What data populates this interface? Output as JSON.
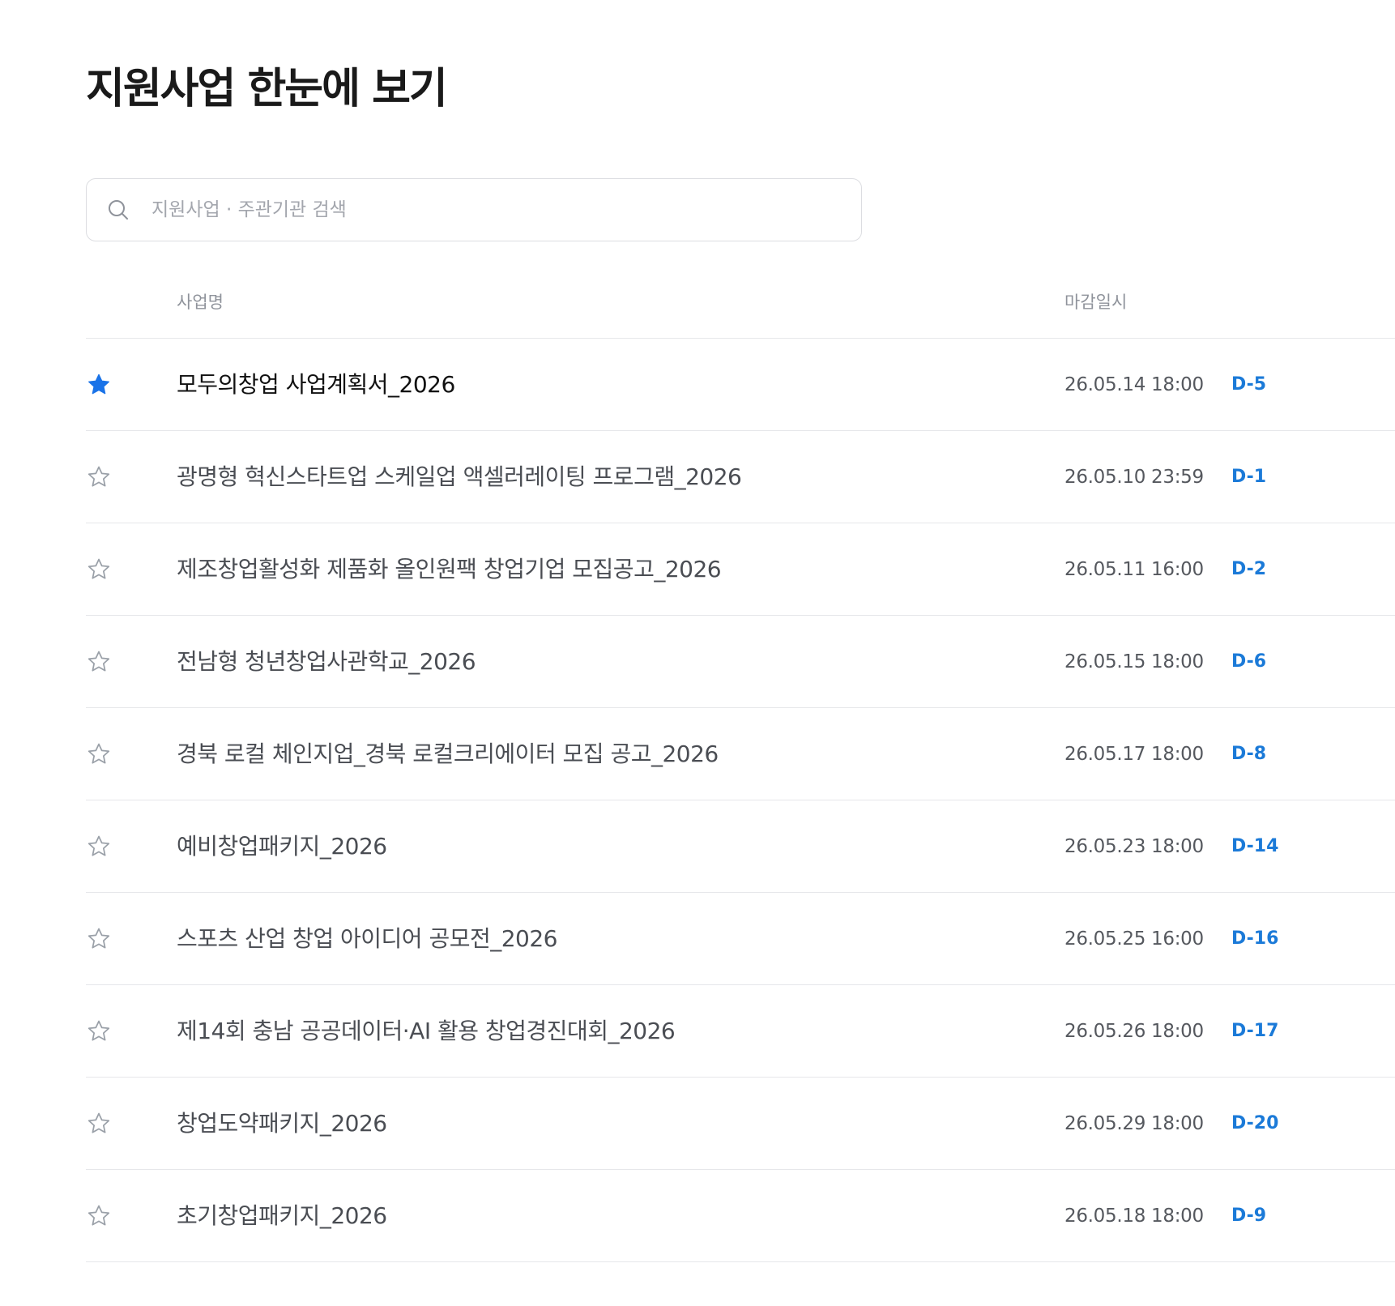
{
  "page": {
    "title": "지원사업 한눈에 보기"
  },
  "search": {
    "placeholder": "지원사업 · 주관기관 검색",
    "value": ""
  },
  "table": {
    "columns": {
      "name": "사업명",
      "deadline": "마감일시"
    },
    "rows": [
      {
        "title": "모두의창업 사업계획서_2026",
        "deadline": "26.05.14 18:00",
        "dday": "D-5",
        "starred": true
      },
      {
        "title": "광명형 혁신스타트업 스케일업 액셀러레이팅 프로그램_2026",
        "deadline": "26.05.10 23:59",
        "dday": "D-1",
        "starred": false
      },
      {
        "title": "제조창업활성화 제품화 올인원팩 창업기업 모집공고_2026",
        "deadline": "26.05.11 16:00",
        "dday": "D-2",
        "starred": false
      },
      {
        "title": "전남형 청년창업사관학교_2026",
        "deadline": "26.05.15 18:00",
        "dday": "D-6",
        "starred": false
      },
      {
        "title": "경북 로컬 체인지업_경북 로컬크리에이터 모집 공고_2026",
        "deadline": "26.05.17 18:00",
        "dday": "D-8",
        "starred": false
      },
      {
        "title": "예비창업패키지_2026",
        "deadline": "26.05.23 18:00",
        "dday": "D-14",
        "starred": false
      },
      {
        "title": "스포츠 산업 창업 아이디어 공모전_2026",
        "deadline": "26.05.25 16:00",
        "dday": "D-16",
        "starred": false
      },
      {
        "title": "제14회 충남 공공데이터·AI 활용 창업경진대회_2026",
        "deadline": "26.05.26 18:00",
        "dday": "D-17",
        "starred": false
      },
      {
        "title": "창업도약패키지_2026",
        "deadline": "26.05.29 18:00",
        "dday": "D-20",
        "starred": false
      },
      {
        "title": "초기창업패키지_2026",
        "deadline": "26.05.18 18:00",
        "dday": "D-9",
        "starred": false
      }
    ]
  },
  "icons": {
    "search": "search-icon",
    "star_filled": "star-filled-icon",
    "star_outline": "star-outline-icon"
  },
  "colors": {
    "accent": "#1b7ad8",
    "star_filled": "#1a73e8",
    "star_outline": "#9aa0a8",
    "divider": "#e6e7ea"
  }
}
